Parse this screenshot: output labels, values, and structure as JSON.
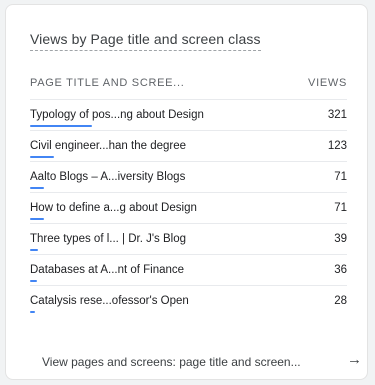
{
  "card": {
    "title": "Views by Page title and screen class"
  },
  "table": {
    "column_title": "PAGE TITLE AND SCREE...",
    "column_views": "VIEWS",
    "rows": [
      {
        "label": "Typology of pos...ng about Design",
        "value": "321",
        "bar_fraction": 1.0
      },
      {
        "label": "Civil engineer...han the degree",
        "value": "123",
        "bar_fraction": 0.383
      },
      {
        "label": "Aalto Blogs – A...iversity Blogs",
        "value": "71",
        "bar_fraction": 0.221
      },
      {
        "label": "How to define a...g about Design",
        "value": "71",
        "bar_fraction": 0.221
      },
      {
        "label": "Three types of l... | Dr. J's Blog",
        "value": "39",
        "bar_fraction": 0.121
      },
      {
        "label": "Databases at A...nt of Finance",
        "value": "36",
        "bar_fraction": 0.112
      },
      {
        "label": "Catalysis rese...ofessor's Open",
        "value": "28",
        "bar_fraction": 0.087
      }
    ]
  },
  "footer": {
    "link_text": "View pages and screens: page title and screen...",
    "arrow_icon": "arrow-right-icon"
  },
  "colors": {
    "bar": "#4285f4"
  }
}
